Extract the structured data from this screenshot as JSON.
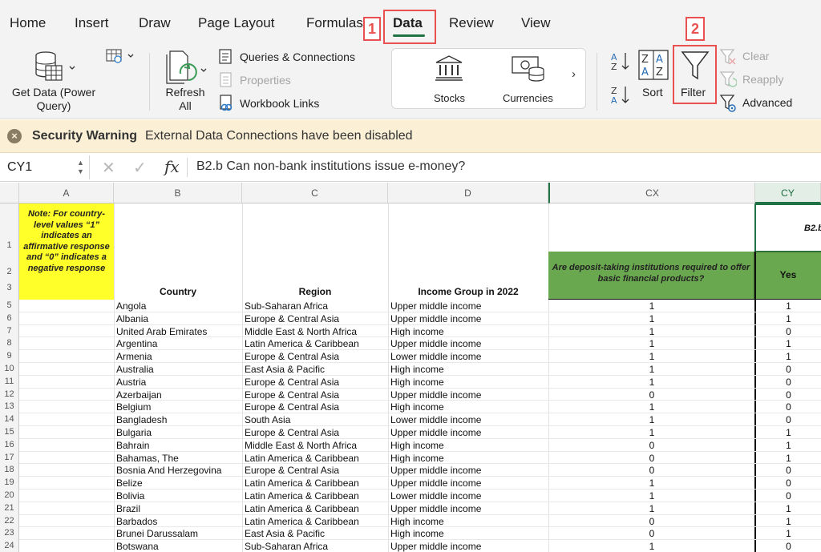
{
  "tabs": [
    {
      "label": "Home",
      "active": false
    },
    {
      "label": "Insert",
      "active": false
    },
    {
      "label": "Draw",
      "active": false
    },
    {
      "label": "Page Layout",
      "active": false
    },
    {
      "label": "Formulas",
      "active": false
    },
    {
      "label": "Data",
      "active": true
    },
    {
      "label": "Review",
      "active": false
    },
    {
      "label": "View",
      "active": false
    }
  ],
  "callouts": {
    "first": "1",
    "second": "2"
  },
  "ribbon": {
    "get_data": "Get Data (Power Query)",
    "refresh": "Refresh All",
    "queries": "Queries & Connections",
    "properties": "Properties",
    "workbook_links": "Workbook Links",
    "stocks": "Stocks",
    "currencies": "Currencies",
    "sort": "Sort",
    "filter": "Filter",
    "clear": "Clear",
    "reapply": "Reapply",
    "advanced": "Advanced"
  },
  "security": {
    "title": "Security Warning",
    "message": "External Data Connections have been disabled"
  },
  "formula_bar": {
    "name_box": "CY1",
    "formula": "B2.b Can non-bank institutions issue e-money?"
  },
  "sheet": {
    "columns": [
      "A",
      "B",
      "C",
      "D",
      "CX",
      "CY"
    ],
    "note": "Note: For country-level values “1” indicates an affirmative response and “0” indicates a negative response",
    "header_country": "Country",
    "header_region": "Region",
    "header_income": "Income Group in 2022",
    "cx_question": "Are deposit-taking institutions required to offer basic financial products?",
    "cy_title": "B2.b",
    "cy_answer": "Yes",
    "header_row_numbers": [
      "1",
      "2",
      "3"
    ],
    "rows": [
      {
        "n": "5",
        "country": "Angola",
        "region": "Sub-Saharan Africa",
        "income": "Upper middle income",
        "cx": "1",
        "cy": "1"
      },
      {
        "n": "6",
        "country": "Albania",
        "region": "Europe & Central Asia",
        "income": "Upper middle income",
        "cx": "1",
        "cy": "1"
      },
      {
        "n": "7",
        "country": "United Arab Emirates",
        "region": "Middle East & North Africa",
        "income": "High income",
        "cx": "1",
        "cy": "0"
      },
      {
        "n": "8",
        "country": "Argentina",
        "region": "Latin America & Caribbean",
        "income": "Upper middle income",
        "cx": "1",
        "cy": "1"
      },
      {
        "n": "9",
        "country": "Armenia",
        "region": "Europe & Central Asia",
        "income": "Lower middle income",
        "cx": "1",
        "cy": "1"
      },
      {
        "n": "10",
        "country": "Australia",
        "region": "East Asia & Pacific",
        "income": "High income",
        "cx": "1",
        "cy": "0"
      },
      {
        "n": "11",
        "country": "Austria",
        "region": "Europe & Central Asia",
        "income": "High income",
        "cx": "1",
        "cy": "0"
      },
      {
        "n": "12",
        "country": "Azerbaijan",
        "region": "Europe & Central Asia",
        "income": "Upper middle income",
        "cx": "0",
        "cy": "0"
      },
      {
        "n": "13",
        "country": "Belgium",
        "region": "Europe & Central Asia",
        "income": "High income",
        "cx": "1",
        "cy": "0"
      },
      {
        "n": "14",
        "country": "Bangladesh",
        "region": "South Asia",
        "income": "Lower middle income",
        "cx": "1",
        "cy": "0"
      },
      {
        "n": "15",
        "country": "Bulgaria",
        "region": "Europe & Central Asia",
        "income": "Upper middle income",
        "cx": "1",
        "cy": "1"
      },
      {
        "n": "16",
        "country": "Bahrain",
        "region": "Middle East & North Africa",
        "income": "High income",
        "cx": "0",
        "cy": "1"
      },
      {
        "n": "17",
        "country": "Bahamas, The",
        "region": "Latin America & Caribbean",
        "income": "High income",
        "cx": "0",
        "cy": "1"
      },
      {
        "n": "18",
        "country": "Bosnia And Herzegovina",
        "region": "Europe & Central Asia",
        "income": "Upper middle income",
        "cx": "0",
        "cy": "0"
      },
      {
        "n": "19",
        "country": "Belize",
        "region": "Latin America & Caribbean",
        "income": "Upper middle income",
        "cx": "1",
        "cy": "0"
      },
      {
        "n": "20",
        "country": "Bolivia",
        "region": "Latin America & Caribbean",
        "income": "Lower middle income",
        "cx": "1",
        "cy": "0"
      },
      {
        "n": "21",
        "country": "Brazil",
        "region": "Latin America & Caribbean",
        "income": "Upper middle income",
        "cx": "1",
        "cy": "1"
      },
      {
        "n": "22",
        "country": "Barbados",
        "region": "Latin America & Caribbean",
        "income": "High income",
        "cx": "0",
        "cy": "1"
      },
      {
        "n": "23",
        "country": "Brunei Darussalam",
        "region": "East Asia & Pacific",
        "income": "High income",
        "cx": "0",
        "cy": "1"
      },
      {
        "n": "24",
        "country": "Botswana",
        "region": "Sub-Saharan Africa",
        "income": "Upper middle income",
        "cx": "1",
        "cy": "0"
      }
    ]
  }
}
